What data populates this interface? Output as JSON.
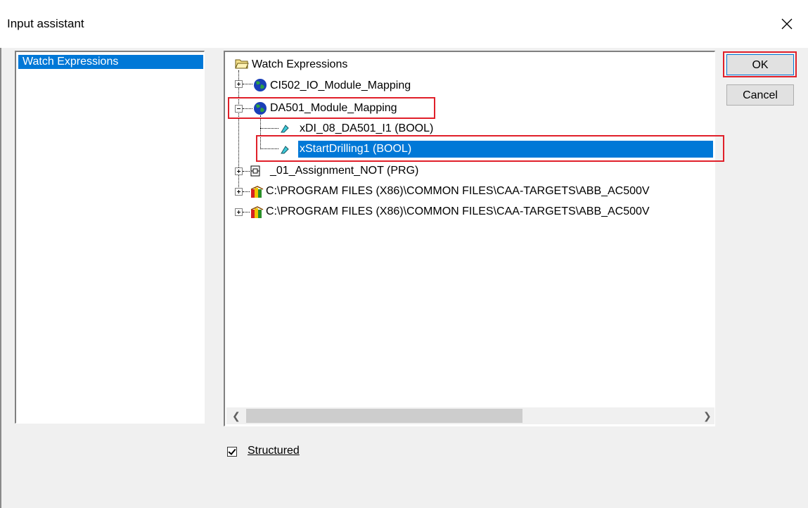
{
  "window": {
    "title": "Input assistant"
  },
  "categories": [
    {
      "label": "Watch Expressions"
    }
  ],
  "tree": {
    "root": "Watch Expressions",
    "nodes": [
      {
        "label": "CI502_IO_Module_Mapping",
        "icon": "globe-icon",
        "expanded": false
      },
      {
        "label": "DA501_Module_Mapping",
        "icon": "globe-icon",
        "expanded": true
      },
      {
        "label": "xDI_08_DA501_I1 (BOOL)",
        "icon": "variable-icon",
        "level": 2
      },
      {
        "label": "xStartDrilling1 (BOOL)",
        "icon": "variable-icon",
        "level": 2,
        "selected": true
      },
      {
        "label": "_01_Assignment_NOT (PRG)",
        "icon": "program-icon",
        "expanded": false
      },
      {
        "label": "C:\\PROGRAM FILES (X86)\\COMMON FILES\\CAA-TARGETS\\ABB_AC500V",
        "icon": "library-icon",
        "expanded": false
      },
      {
        "label": "C:\\PROGRAM FILES (X86)\\COMMON FILES\\CAA-TARGETS\\ABB_AC500V",
        "icon": "library-icon",
        "expanded": false
      }
    ]
  },
  "buttons": {
    "ok": "OK",
    "cancel": "Cancel"
  },
  "structured": {
    "label": "Structured",
    "checked": true
  },
  "colors": {
    "selection": "#0078d7",
    "highlight": "#e0202a"
  }
}
